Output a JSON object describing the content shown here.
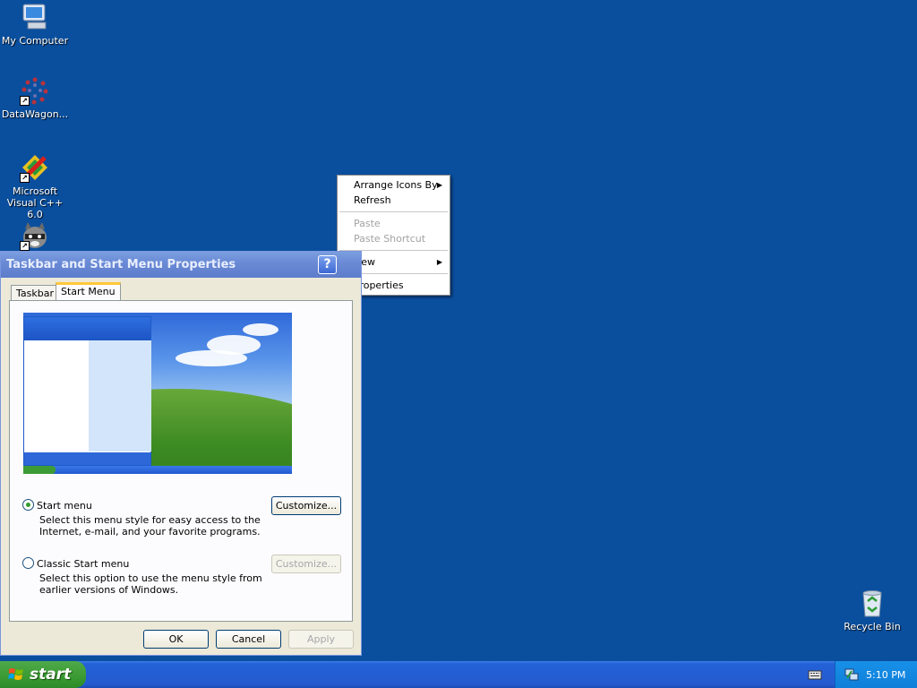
{
  "desktop": {
    "icons": [
      {
        "label": "My Computer"
      },
      {
        "label": "DataWagon..."
      },
      {
        "label": "Microsoft Visual C++ 6.0"
      },
      {
        "label": ""
      },
      {
        "label": "Recycle Bin"
      }
    ]
  },
  "context_menu": {
    "items": [
      "Arrange Icons By",
      "Refresh",
      "Paste",
      "Paste Shortcut",
      "New",
      "Properties"
    ]
  },
  "dialog": {
    "title": "Taskbar and Start Menu Properties",
    "help_glyph": "?",
    "tabs": [
      "Taskbar",
      "Start Menu"
    ],
    "options": [
      {
        "label": "Start menu",
        "description": "Select this menu style for easy access to the Internet, e-mail, and your favorite programs.",
        "checked": true,
        "button": "Customize..."
      },
      {
        "label": "Classic Start menu",
        "description": "Select this option to use the menu style from earlier versions of Windows.",
        "checked": false,
        "button": "Customize..."
      }
    ],
    "buttons": {
      "ok": "OK",
      "cancel": "Cancel",
      "apply": "Apply"
    }
  },
  "taskbar": {
    "start_label": "start",
    "clock": "5:10 PM"
  },
  "colors": {
    "desktop": "#0a4f9e",
    "taskbar": "#245bd1",
    "start_button": "#3a9a32",
    "title_bar": "#6b8bd6",
    "dialog_face": "#ece9d8"
  }
}
